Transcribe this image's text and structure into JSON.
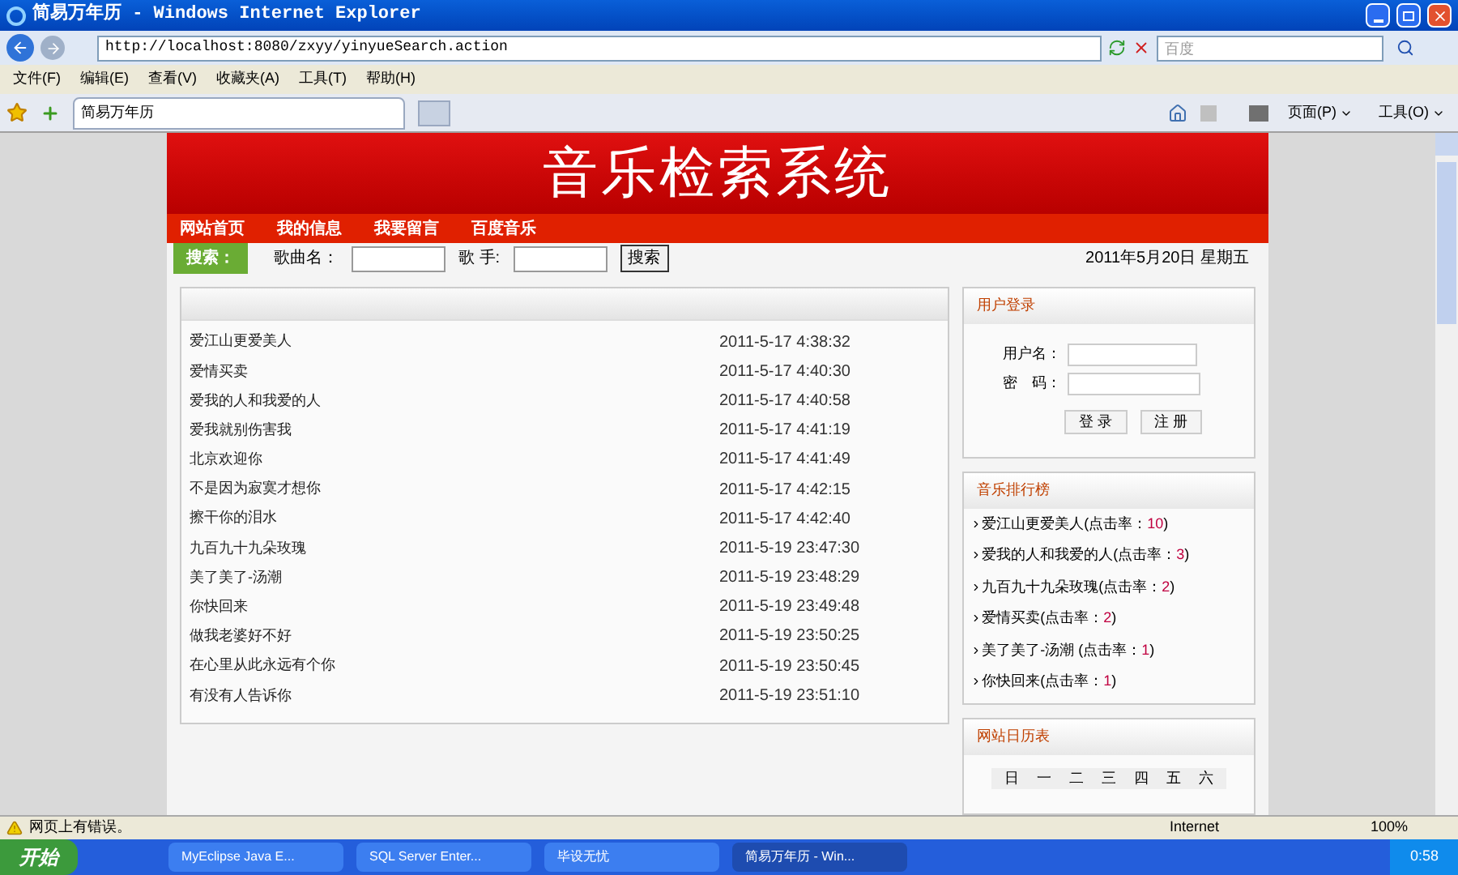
{
  "window": {
    "title": "简易万年历 - Windows Internet Explorer"
  },
  "address": {
    "url": "http://localhost:8080/zxyy/yinyueSearch.action"
  },
  "search_box": {
    "placeholder": "百度"
  },
  "menu": [
    "文件(F)",
    "编辑(E)",
    "查看(V)",
    "收藏夹(A)",
    "工具(T)",
    "帮助(H)"
  ],
  "tabs": [
    {
      "label": "简易万年历",
      "selected": true
    }
  ],
  "command_bar": [
    {
      "label": "页面(P)"
    },
    {
      "label": "工具(O)"
    }
  ],
  "page": {
    "banner": "音乐检索系统",
    "nav": [
      "网站首页",
      "我的信息",
      "我要留言",
      "百度音乐"
    ],
    "search": {
      "badge": "搜索：",
      "song_label": "歌曲名：",
      "singer_label": "歌 手:",
      "button": "搜索"
    },
    "date": "2011年5月20日 星期五",
    "songs": [
      {
        "title": "爱江山更爱美人",
        "time": "2011-5-17 4:38:32"
      },
      {
        "title": "爱情买卖",
        "time": "2011-5-17 4:40:30"
      },
      {
        "title": "爱我的人和我爱的人",
        "time": "2011-5-17 4:40:58"
      },
      {
        "title": "爱我就别伤害我",
        "time": "2011-5-17 4:41:19"
      },
      {
        "title": "北京欢迎你",
        "time": "2011-5-17 4:41:49"
      },
      {
        "title": "不是因为寂寞才想你",
        "time": "2011-5-17 4:42:15"
      },
      {
        "title": "擦干你的泪水",
        "time": "2011-5-17 4:42:40"
      },
      {
        "title": "九百九十九朵玫瑰",
        "time": "2011-5-19 23:47:30"
      },
      {
        "title": "美了美了-汤潮",
        "time": "2011-5-19 23:48:29"
      },
      {
        "title": "你快回来",
        "time": "2011-5-19 23:49:48"
      },
      {
        "title": "做我老婆好不好",
        "time": "2011-5-19 23:50:25"
      },
      {
        "title": "在心里从此永远有个你",
        "time": "2011-5-19 23:50:45"
      },
      {
        "title": "有没有人告诉你",
        "time": "2011-5-19 23:51:10"
      }
    ],
    "login": {
      "title": "用户登录",
      "user_label": "用户名：",
      "password_label": "密　码：",
      "buttons": [
        "登 录",
        "注 册"
      ]
    },
    "ranking": {
      "title": "音乐排行榜",
      "items": [
        {
          "text": "爱江山更爱美人(点击率：",
          "count": "10",
          "suffix": ")"
        },
        {
          "text": "爱我的人和我爱的人(点击率：",
          "count": "3",
          "suffix": ")"
        },
        {
          "text": "九百九十九朵玫瑰(点击率：",
          "count": "2",
          "suffix": ")"
        },
        {
          "text": "爱情买卖(点击率：",
          "count": "2",
          "suffix": ")"
        },
        {
          "text": "美了美了-汤潮 (点击率：",
          "count": "1",
          "suffix": ")"
        },
        {
          "text": "你快回来(点击率：",
          "count": "1",
          "suffix": ")"
        }
      ]
    },
    "calendar": {
      "title": "网站日历表",
      "weekdays": [
        "日",
        "一",
        "二",
        "三",
        "四",
        "五",
        "六"
      ]
    }
  },
  "status_bar": {
    "message": "网页上有错误。",
    "zone": "Internet",
    "zoom": "100%"
  },
  "taskbar": {
    "start": "开始",
    "items": [
      {
        "label": "MyEclipse Java E...",
        "selected": false
      },
      {
        "label": "SQL Server Enter...",
        "selected": false
      },
      {
        "label": "毕设无忧",
        "selected": false
      },
      {
        "label": "简易万年历 - Win...",
        "selected": true
      }
    ],
    "clock": "0:58"
  }
}
